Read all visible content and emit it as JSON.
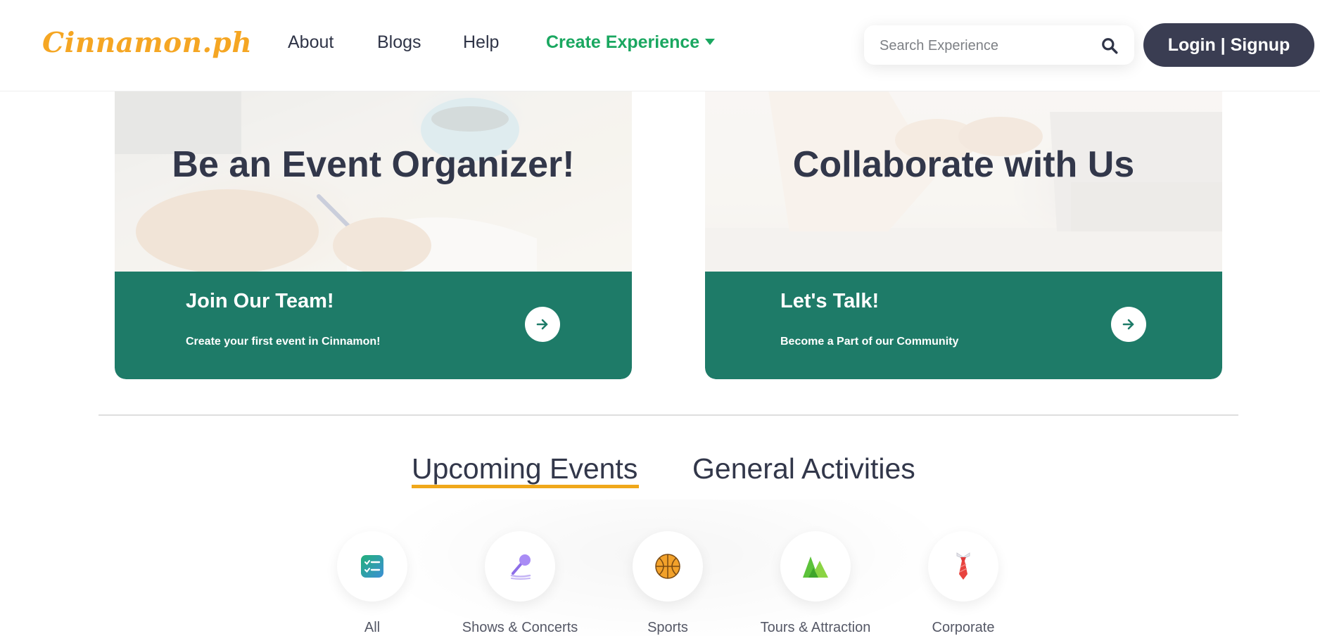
{
  "header": {
    "logo": "Cinnamon.ph",
    "nav": [
      {
        "label": "About"
      },
      {
        "label": "Blogs"
      },
      {
        "label": "Help"
      }
    ],
    "create_label": "Create Experience",
    "search_placeholder": "Search Experience",
    "login_label": "Login | Signup"
  },
  "cards": [
    {
      "heading": "Be an Event Organizer!",
      "band_title": "Join Our Team!",
      "band_subtitle": "Create your first event in Cinnamon!"
    },
    {
      "heading": "Collaborate with Us",
      "band_title": "Let's Talk!",
      "band_subtitle": "Become a Part of our Community"
    }
  ],
  "tabs": [
    {
      "label": "Upcoming Events",
      "active": true
    },
    {
      "label": "General Activities",
      "active": false
    }
  ],
  "categories": [
    {
      "label": "All",
      "icon": "checklist-icon"
    },
    {
      "label": "Shows & Concerts",
      "icon": "microphone-icon"
    },
    {
      "label": "Sports",
      "icon": "basketball-icon"
    },
    {
      "label": "Tours & Attraction",
      "icon": "mountain-icon"
    },
    {
      "label": "Corporate",
      "icon": "necktie-icon"
    }
  ],
  "colors": {
    "brand": "#f5a623",
    "accent_green": "#1aa760",
    "band_green": "#1e7b68",
    "dark": "#3a3d52",
    "tab_underline": "#f0a81a"
  }
}
